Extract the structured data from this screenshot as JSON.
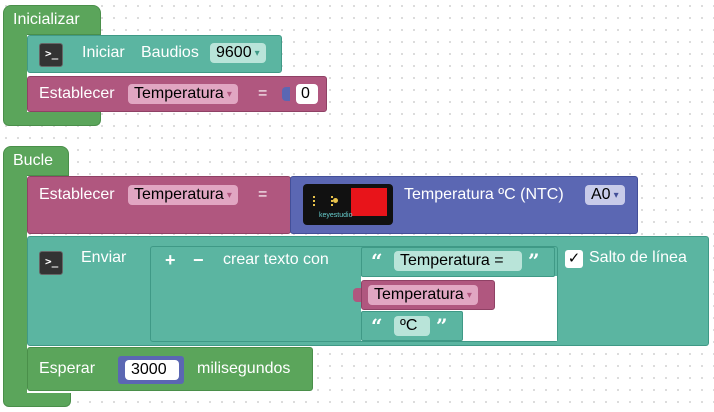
{
  "init": {
    "title": "Inicializar",
    "serial": {
      "label1": "Iniciar",
      "label2": "Baudios",
      "baud": "9600"
    },
    "set": {
      "label": "Establecer",
      "var": "Temperatura",
      "eq": "=",
      "value": "0"
    }
  },
  "loop": {
    "title": "Bucle",
    "set": {
      "label": "Establecer",
      "var": "Temperatura",
      "eq": "="
    },
    "sensor": {
      "label": "Temperatura ºC (NTC)",
      "pin": "A0",
      "brand": "keyestudio"
    },
    "send": {
      "label": "Enviar",
      "plus": "+",
      "minus": "−",
      "create": "crear texto con",
      "text1": "Temperatura =",
      "var": "Temperatura",
      "text2": "ºC",
      "newline": "Salto de línea",
      "check": "✓"
    },
    "wait": {
      "label": "Esperar",
      "value": "3000",
      "unit": "milisegundos"
    }
  },
  "open_quote": "“",
  "close_quote": "”",
  "dropdown_arrow": "▾",
  "terminal_icon": ">_"
}
